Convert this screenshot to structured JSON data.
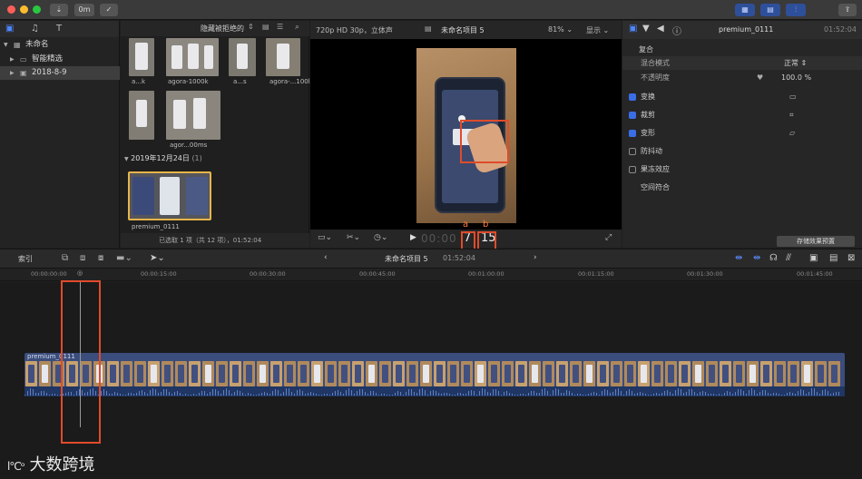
{
  "toolbar": {
    "import_icon": "download-icon",
    "key_label": "0m",
    "check_icon": "checkmark-circle-icon",
    "share_icon": "share-icon"
  },
  "library": {
    "items": [
      {
        "label": "未命名"
      },
      {
        "label": "智能精选"
      },
      {
        "label": "2018-8-9"
      }
    ]
  },
  "browser": {
    "filter": "隐藏被拒绝的",
    "group_date": "2019年12月24日",
    "group_count": "(1)",
    "clips_row1": [
      "a...k",
      "agora-1000k",
      "a...s",
      "agora-...100k"
    ],
    "clips_row2": [
      "agor...00ms"
    ],
    "group_clip": "premium_0111",
    "status": "已选取 1 项（共 12 项），01:52:04"
  },
  "viewer": {
    "format": "720p HD 30p，立体声",
    "project": "未命名项目 5",
    "zoom": "81%",
    "view": "显示",
    "timecode_dim": "00:00",
    "timecode_a": "7",
    "timecode_b": "15",
    "label_a": "a",
    "label_b": "b"
  },
  "inspector": {
    "clip_name": "premium_0111",
    "duration": "01:52:04",
    "section": "复合",
    "blend_label": "混合模式",
    "blend_value": "正常",
    "opacity_label": "不透明度",
    "opacity_value": "100.0 %",
    "rows": [
      {
        "label": "变换",
        "checked": true
      },
      {
        "label": "裁剪",
        "checked": true
      },
      {
        "label": "变形",
        "checked": true
      },
      {
        "label": "防抖动",
        "checked": false
      },
      {
        "label": "果冻效应",
        "checked": false
      },
      {
        "label": "空间符合",
        "checked": null
      }
    ],
    "save_preset": "存储效果预置"
  },
  "timeline": {
    "index_label": "索引",
    "project": "未命名项目 5",
    "duration": "01:52:04",
    "ruler": [
      "00:00:00:00",
      "00:00:15:00",
      "00:00:30:00",
      "00:00:45:00",
      "00:01:00:00",
      "00:01:15:00",
      "00:01:30:00",
      "00:01:45:00"
    ],
    "clip_name": "premium_0111"
  },
  "watermark": "大数跨境",
  "colors": {
    "accent": "#3a6ee8",
    "clip": "#3b4d7c",
    "annotation": "#e04b2a"
  }
}
